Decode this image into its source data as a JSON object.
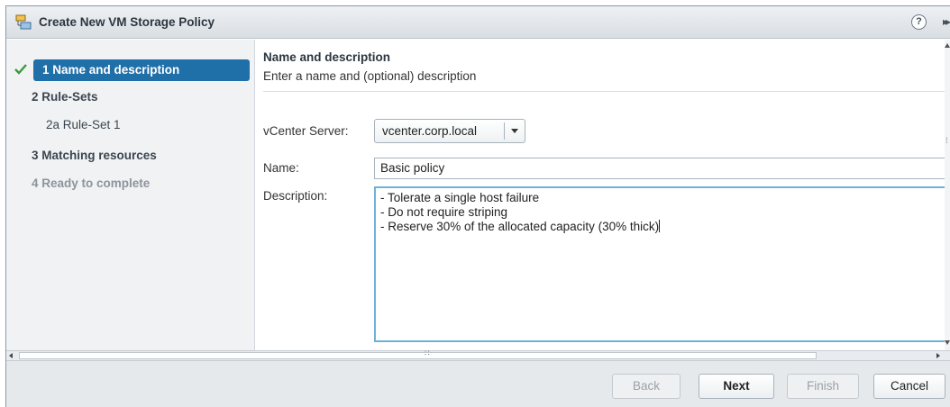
{
  "window": {
    "title": "Create New VM Storage Policy",
    "help_label": "?",
    "expand_label": "▸▸"
  },
  "nav": {
    "items": [
      {
        "label": "1 Name and description",
        "state": "active",
        "completed": true
      },
      {
        "label": "2 Rule-Sets",
        "state": "normal"
      },
      {
        "label": "2a Rule-Set 1",
        "state": "sub"
      },
      {
        "label": "3 Matching resources",
        "state": "normal"
      },
      {
        "label": "4 Ready to complete",
        "state": "disabled"
      }
    ]
  },
  "content": {
    "title": "Name and description",
    "subtitle": "Enter a name and (optional) description",
    "vcenter_label": "vCenter Server:",
    "vcenter_value": "vcenter.corp.local",
    "name_label": "Name:",
    "name_value": "Basic policy",
    "description_label": "Description:",
    "description_value": "- Tolerate a single host failure\n- Do not require striping\n- Reserve 30% of the allocated capacity (30% thick)"
  },
  "footer": {
    "back_label": "Back",
    "next_label": "Next",
    "finish_label": "Finish",
    "cancel_label": "Cancel"
  },
  "colors": {
    "active_nav": "#1f6fa9",
    "check": "#3a9a3a",
    "focus_border": "#6fb1dd"
  }
}
